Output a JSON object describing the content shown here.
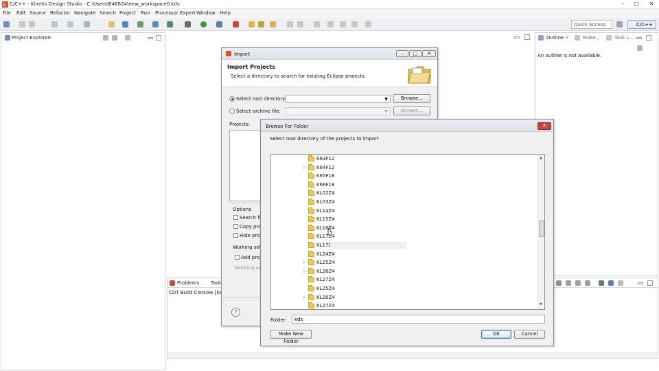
{
  "window": {
    "title": "C/C++ - Kinetis Design Studio - C:\\Users\\B46824\\new_workspace0.kds",
    "controls": [
      "–",
      "□",
      "✕"
    ]
  },
  "menubar": [
    "File",
    "Edit",
    "Source",
    "Refactor",
    "Navigate",
    "Search",
    "Project",
    "Run",
    "Processor Expert",
    "Window",
    "Help"
  ],
  "toolbar": {
    "quick_access_placeholder": "Quick Access",
    "perspective": "C/C++"
  },
  "project_explorer": {
    "title": "Project Explorer"
  },
  "outline": {
    "tabs": [
      "Outline",
      "Make...",
      "Task L..."
    ],
    "message": "An outline is not available."
  },
  "bottom_panel": {
    "tabs": [
      "Problems",
      "Tasks"
    ],
    "console_title": "CDT Build Console [ksdk"
  },
  "import_dialog": {
    "title": "Import",
    "heading": "Import Projects",
    "description": "Select a directory to search for existing Eclipse projects.",
    "select_root_label": "Select root directory:",
    "select_archive_label": "Select archive file:",
    "browse_label": "Browse...",
    "browse2_label": "Browse...",
    "projects_label": "Projects:",
    "options_label": "Options",
    "option_search": "Search for",
    "option_copy": "Copy proj",
    "option_hide": "Hide proje",
    "working_sets_label": "Working sets",
    "add_project_label": "Add proje",
    "working_set_label": "Working set",
    "help_symbol": "?"
  },
  "browse_dialog": {
    "title": "Browse For Folder",
    "instruction": "Select root directory of the projects to import",
    "folders": [
      {
        "name": "K63F12",
        "expandable": false
      },
      {
        "name": "K64F12",
        "expandable": true
      },
      {
        "name": "K65F18",
        "expandable": false
      },
      {
        "name": "K66F18",
        "expandable": false
      },
      {
        "name": "KL02Z4",
        "expandable": false
      },
      {
        "name": "KL03Z4",
        "expandable": false
      },
      {
        "name": "KL14Z4",
        "expandable": false
      },
      {
        "name": "KL15Z4",
        "expandable": false
      },
      {
        "name": "KL16Z4",
        "expandable": false
      },
      {
        "name": "KL17Z4",
        "expandable": false
      },
      {
        "name": "KL17Z",
        "expandable": false
      },
      {
        "name": "KL24Z4",
        "expandable": false
      },
      {
        "name": "KL25Z4",
        "expandable": true
      },
      {
        "name": "KL26Z4",
        "expandable": true
      },
      {
        "name": "KL27Z4",
        "expandable": false
      },
      {
        "name": "KL25Z4",
        "expandable": false
      },
      {
        "name": "KL26Z4",
        "expandable": true
      },
      {
        "name": "KL27Z4",
        "expandable": false
      }
    ],
    "folder_label": "Folder:",
    "folder_value": "kds",
    "make_new_folder": "Make New Folder",
    "ok": "OK",
    "cancel": "Cancel",
    "close": "✕"
  }
}
